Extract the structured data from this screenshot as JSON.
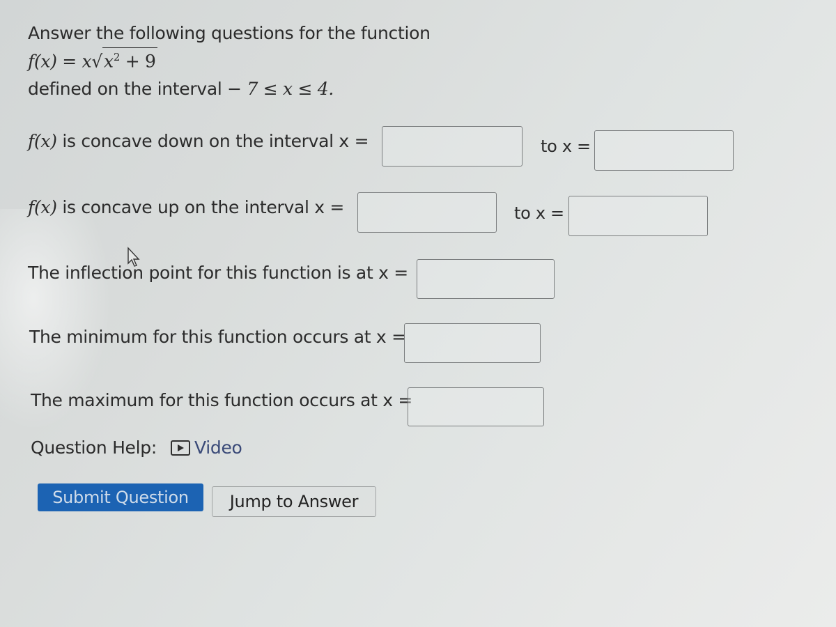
{
  "intro": {
    "line1": "Answer the following questions for the function",
    "function_lhs": "f(x) = x",
    "function_sqrt_base": "x",
    "function_sqrt_exp": "2",
    "function_sqrt_rest": " + 9",
    "line3_prefix": "defined on the interval ",
    "interval": "− 7 ≤ x ≤ 4."
  },
  "questions": {
    "concave_down": {
      "func": "f(x)",
      "label": " is concave down on the interval x =",
      "to_label": "to x =",
      "from_value": "",
      "to_value": ""
    },
    "concave_up": {
      "func": "f(x)",
      "label": " is concave up on the interval x =",
      "to_label": "to x =",
      "from_value": "",
      "to_value": ""
    },
    "inflection": {
      "label": "The inflection point for this function is at x =",
      "value": ""
    },
    "minimum": {
      "label": "The minimum for this function occurs at x =",
      "value": ""
    },
    "maximum": {
      "label": "The maximum for this function occurs at x =",
      "value": ""
    }
  },
  "help": {
    "label": "Question Help:",
    "video_icon": "video-play-icon",
    "video_label": "Video"
  },
  "buttons": {
    "submit": "Submit Question",
    "jump": "Jump to Answer"
  },
  "colors": {
    "submit_bg": "#1c63b3",
    "link": "#3a4a78"
  }
}
